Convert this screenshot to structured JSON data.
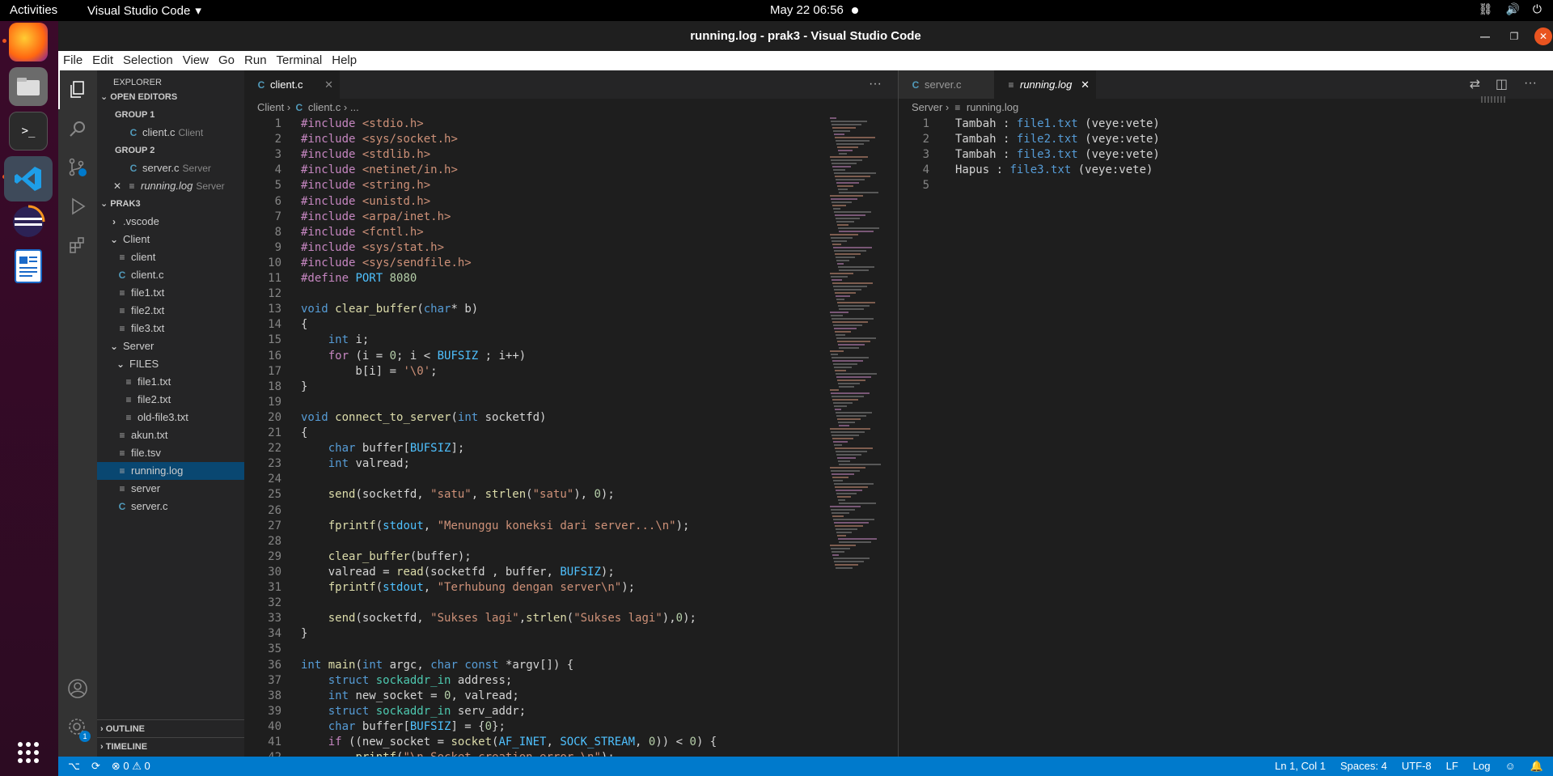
{
  "topbar": {
    "activities": "Activities",
    "app": "Visual Studio Code",
    "clock": "May 22  06:56"
  },
  "window": {
    "title": "running.log - prak3 - Visual Studio Code"
  },
  "menu": [
    "File",
    "Edit",
    "Selection",
    "View",
    "Go",
    "Run",
    "Terminal",
    "Help"
  ],
  "explorer": {
    "title": "EXPLORER",
    "open_editors": "OPEN EDITORS",
    "group1": "GROUP 1",
    "group2": "GROUP 2",
    "open": [
      {
        "name": "client.c",
        "desc": "Client"
      },
      {
        "name": "server.c",
        "desc": "Server"
      },
      {
        "name": "running.log",
        "desc": "Server"
      }
    ],
    "project": "PRAK3",
    "tree": [
      ".vscode",
      "Client",
      "client",
      "client.c",
      "file1.txt",
      "file2.txt",
      "file3.txt",
      "Server",
      "FILES",
      "file1.txt",
      "file2.txt",
      "old-file3.txt",
      "akun.txt",
      "file.tsv",
      "running.log",
      "server",
      "server.c"
    ],
    "outline": "OUTLINE",
    "timeline": "TIMELINE"
  },
  "editor1": {
    "tab": "client.c",
    "crumb": {
      "folder": "Client",
      "file": "client.c",
      "more": "..."
    },
    "lines": [
      "#include <stdio.h>",
      "#include <sys/socket.h>",
      "#include <stdlib.h>",
      "#include <netinet/in.h>",
      "#include <string.h>",
      "#include <unistd.h>",
      "#include <arpa/inet.h>",
      "#include <fcntl.h>",
      "#include <sys/stat.h>",
      "#include <sys/sendfile.h>",
      "#define PORT 8080",
      "",
      "void clear_buffer(char* b)",
      "{",
      "    int i;",
      "    for (i = 0; i < BUFSIZ ; i++)",
      "        b[i] = '\\0';",
      "}",
      "",
      "void connect_to_server(int socketfd)",
      "{",
      "    char buffer[BUFSIZ];",
      "    int valread;",
      "",
      "    send(socketfd, \"satu\", strlen(\"satu\"), 0);",
      "",
      "    fprintf(stdout, \"Menunggu koneksi dari server...\\n\");",
      "",
      "    clear_buffer(buffer);",
      "    valread = read(socketfd , buffer, BUFSIZ);",
      "    fprintf(stdout, \"Terhubung dengan server\\n\");",
      "",
      "    send(socketfd, \"Sukses lagi\",strlen(\"Sukses lagi\"),0);",
      "}",
      "",
      "int main(int argc, char const *argv[]) {",
      "    struct sockaddr_in address;",
      "    int new_socket = 0, valread;",
      "    struct sockaddr_in serv_addr;",
      "    char buffer[BUFSIZ] = {0};",
      "    if ((new_socket = socket(AF_INET, SOCK_STREAM, 0)) < 0) {",
      "        printf(\"\\n Socket creation error \\n\");"
    ]
  },
  "editor2": {
    "tab_inactive": "server.c",
    "tab_active": "running.log",
    "crumb": {
      "folder": "Server",
      "file": "running.log"
    },
    "lines": [
      {
        "pre": "Tambah : ",
        "file": "file1.txt",
        "post": " (veye:vete)"
      },
      {
        "pre": "Tambah : ",
        "file": "file2.txt",
        "post": " (veye:vete)"
      },
      {
        "pre": "Tambah : ",
        "file": "file3.txt",
        "post": " (veye:vete)"
      },
      {
        "pre": "Hapus : ",
        "file": "file3.txt",
        "post": " (veye:vete)"
      },
      {
        "pre": "",
        "file": "",
        "post": ""
      }
    ]
  },
  "status": {
    "branch": "",
    "problems": "⊗ 0 ⚠ 0",
    "position": "Ln 1, Col 1",
    "spaces": "Spaces: 4",
    "encoding": "UTF-8",
    "eol": "LF",
    "lang": "Log"
  },
  "badge": "1",
  "colors": {
    "accent": "#007acc",
    "selection": "#094771"
  }
}
